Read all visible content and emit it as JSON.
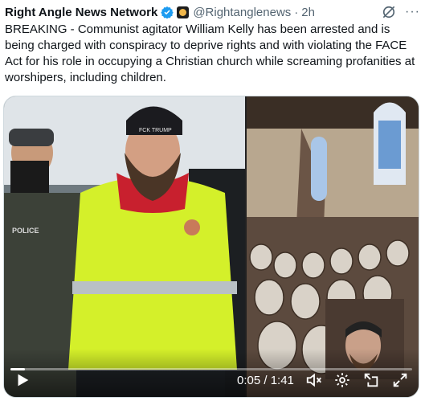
{
  "tweet": {
    "display_name": "Right Angle News Network",
    "handle": "@Rightanglenews",
    "separator": "·",
    "time": "2h",
    "more_label": "···",
    "text": "BREAKING - Communist agitator William Kelly has been arrested and is being charged with conspiracy to deprive rights and with violating the FACE Act for his role in occupying a Christian church while screaming profanities at worshipers, including children."
  },
  "media": {
    "police_label": "POLICE",
    "hat_text": "FCK TRUMP",
    "timecode": "0:05 / 1:41",
    "progress_fraction": 0.035,
    "colors": {
      "verified": "#1d9bf0",
      "vest": "#d4f02a",
      "scarf": "#c8202e"
    },
    "icons": [
      "play-icon",
      "volume-muted-icon",
      "settings-gear-icon",
      "picture-in-picture-icon",
      "fullscreen-icon"
    ]
  }
}
